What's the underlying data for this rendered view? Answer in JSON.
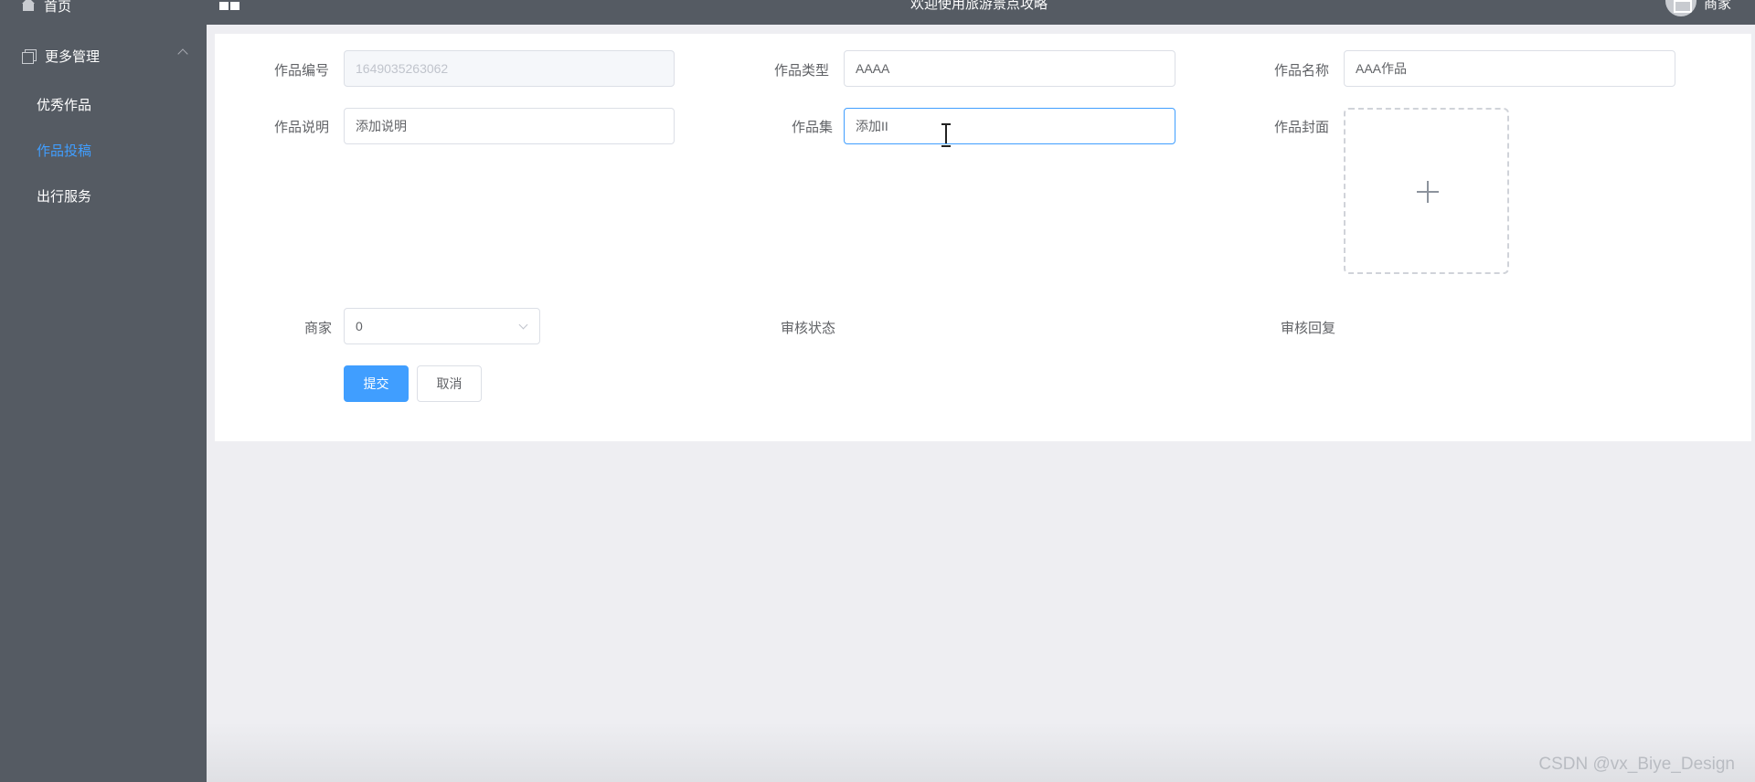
{
  "topbar": {
    "welcome": "欢迎使用旅游景点攻略",
    "username": "商家"
  },
  "sidebar": {
    "home": "首页",
    "group": "更多管理",
    "items": [
      {
        "label": "优秀作品"
      },
      {
        "label": "作品投稿"
      },
      {
        "label": "出行服务"
      }
    ]
  },
  "form": {
    "work_no_label": "作品编号",
    "work_no_value": "1649035263062",
    "work_type_label": "作品类型",
    "work_type_value": "AAAA",
    "work_name_label": "作品名称",
    "work_name_value": "AAA作品",
    "work_desc_label": "作品说明",
    "work_desc_value": "添加说明",
    "work_set_label": "作品集",
    "work_set_value": "添加II",
    "work_cover_label": "作品封面",
    "merchant_label": "商家",
    "merchant_value": "0",
    "review_status_label": "审核状态",
    "review_reply_label": "审核回复",
    "submit": "提交",
    "cancel": "取消"
  },
  "watermark": "CSDN @vx_Biye_Design"
}
